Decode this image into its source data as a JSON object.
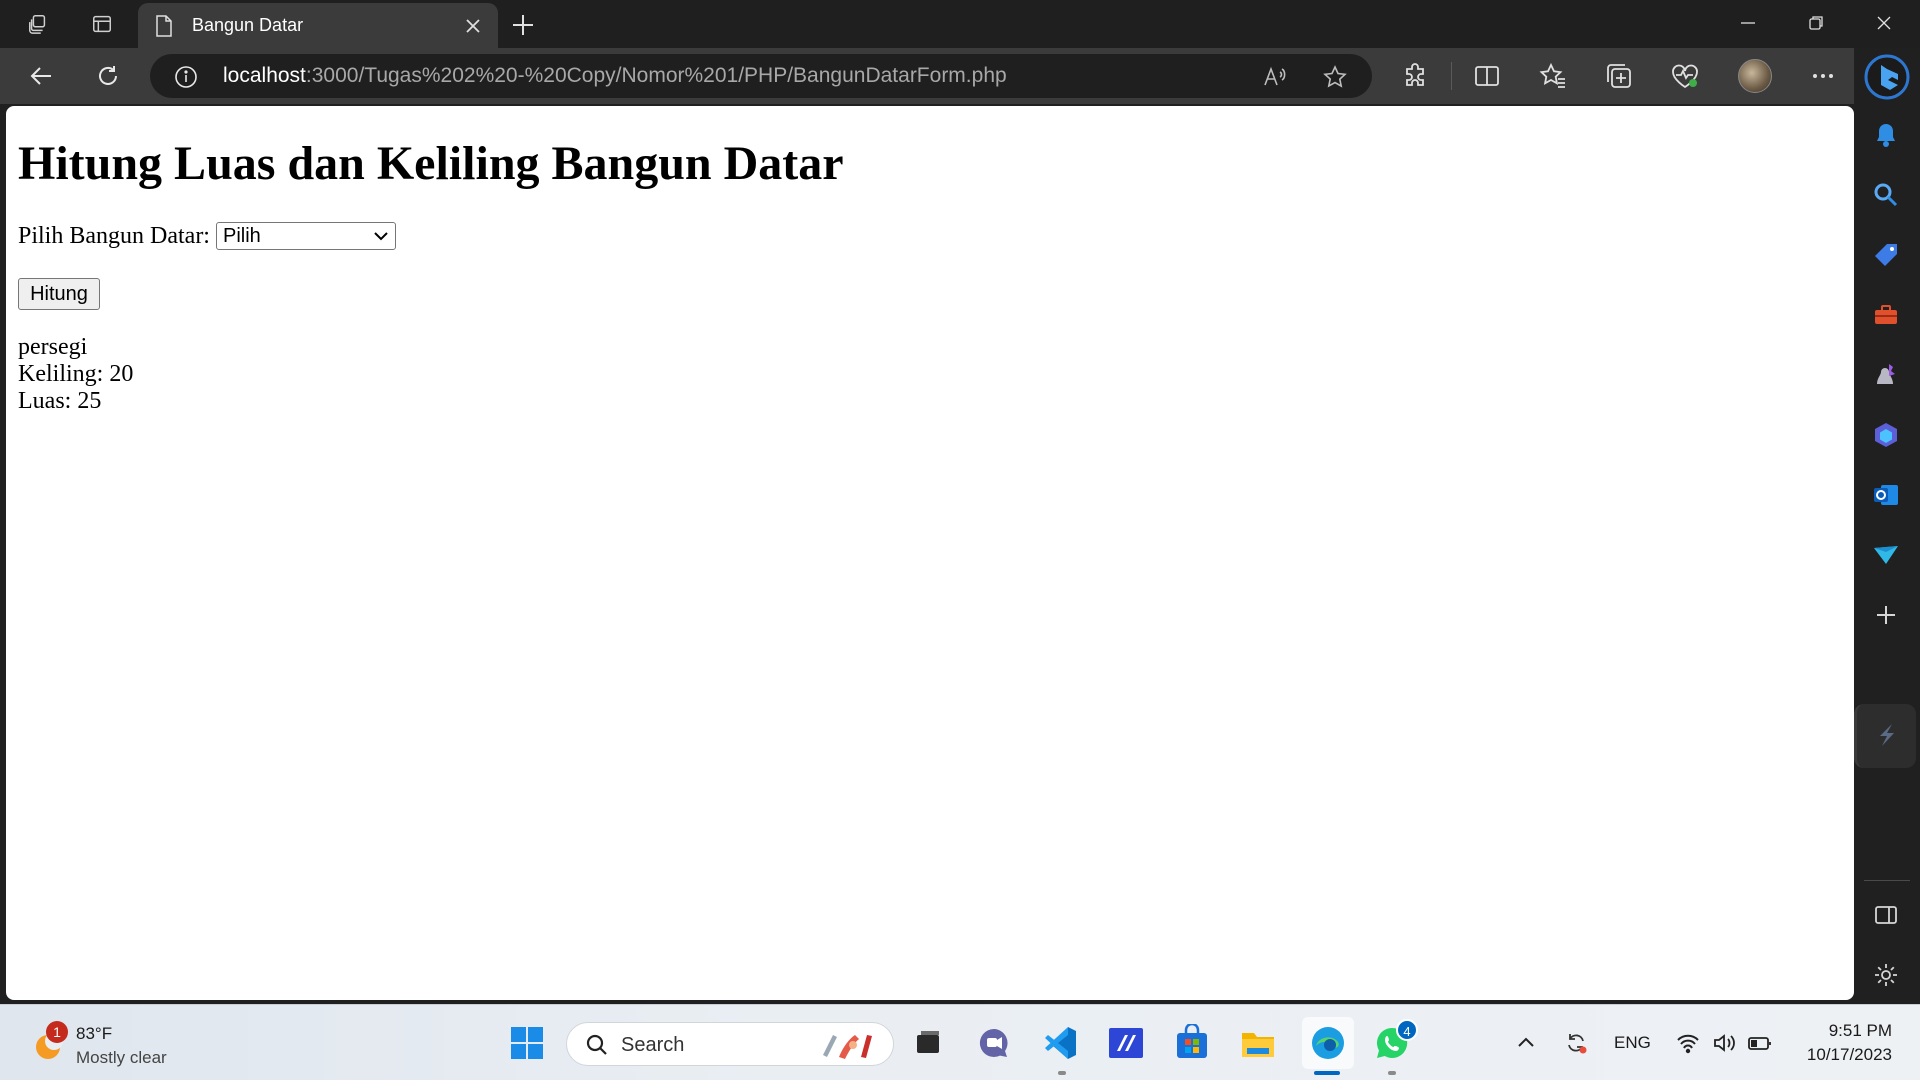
{
  "browser": {
    "tab": {
      "title": "Bangun Datar"
    },
    "address": {
      "host": "localhost",
      "path": ":3000/Tugas%202%20-%20Copy/Nomor%201/PHP/BangunDatarForm.php"
    }
  },
  "page": {
    "heading": "Hitung Luas dan Keliling Bangun Datar",
    "select_label": "Pilih Bangun Datar:",
    "select_value": "Pilih",
    "submit_label": "Hitung",
    "result": {
      "shape": "persegi",
      "keliling": "Keliling: 20",
      "luas": "Luas: 25"
    }
  },
  "sidebar": {
    "icons": [
      "bell-icon",
      "search-icon",
      "tag-icon",
      "toolbox-icon",
      "games-icon",
      "copilot-icon",
      "outlook-icon",
      "send-icon",
      "add-icon"
    ]
  },
  "taskbar": {
    "weather": {
      "temp": "83°F",
      "condition": "Mostly clear",
      "badge": "1"
    },
    "search_placeholder": "Search",
    "whatsapp_badge": "4",
    "language": "ENG",
    "time": "9:51 PM",
    "date": "10/17/2023"
  },
  "colors": {
    "accent": "#0067c0",
    "chrome_dark": "#1f1f1f",
    "toolbar": "#3b3b3b",
    "edge_blue": "#1a73e8"
  }
}
